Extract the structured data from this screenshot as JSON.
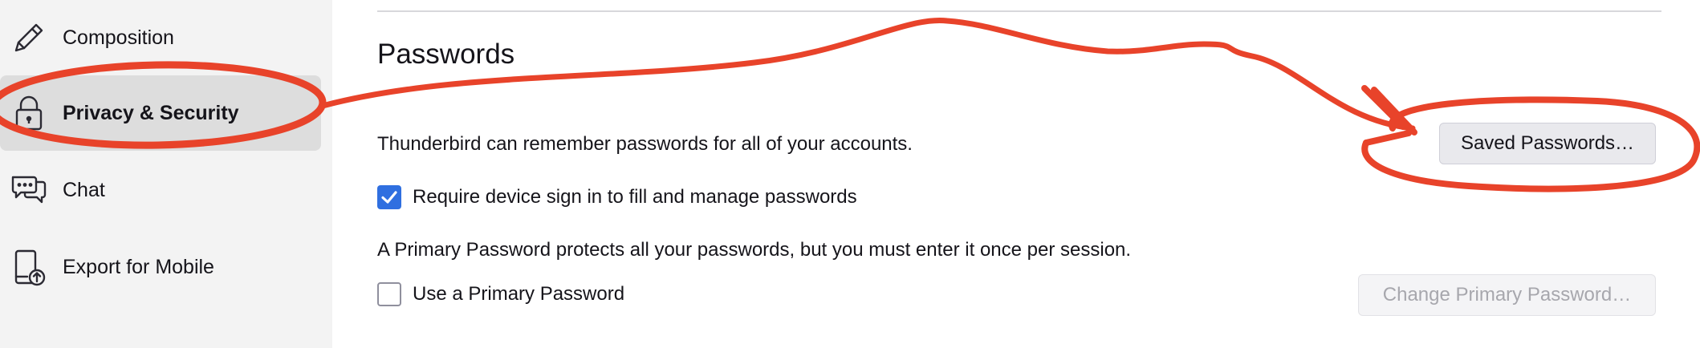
{
  "sidebar": {
    "items": [
      {
        "label": "Composition",
        "icon": "pencil-icon"
      },
      {
        "label": "Privacy & Security",
        "icon": "lock-icon",
        "selected": true
      },
      {
        "label": "Chat",
        "icon": "chat-bubbles-icon"
      },
      {
        "label": "Export for Mobile",
        "icon": "mobile-export-icon"
      }
    ]
  },
  "passwords": {
    "title": "Passwords",
    "remember_text": "Thunderbird can remember passwords for all of your accounts.",
    "saved_passwords_button": "Saved Passwords…",
    "require_signin": {
      "label": "Require device sign in to fill and manage passwords",
      "checked": true
    },
    "primary_password_text": "A Primary Password protects all your passwords, but you must enter it once per session.",
    "use_primary_password": {
      "label": "Use a Primary Password",
      "checked": false
    },
    "change_primary_password_button": "Change Primary Password…"
  },
  "colors": {
    "annotation": "#e8432a",
    "checkbox_checked": "#2f6fe0",
    "sidebar_bg": "#f3f3f3",
    "sidebar_selected_bg": "#dddddd"
  }
}
